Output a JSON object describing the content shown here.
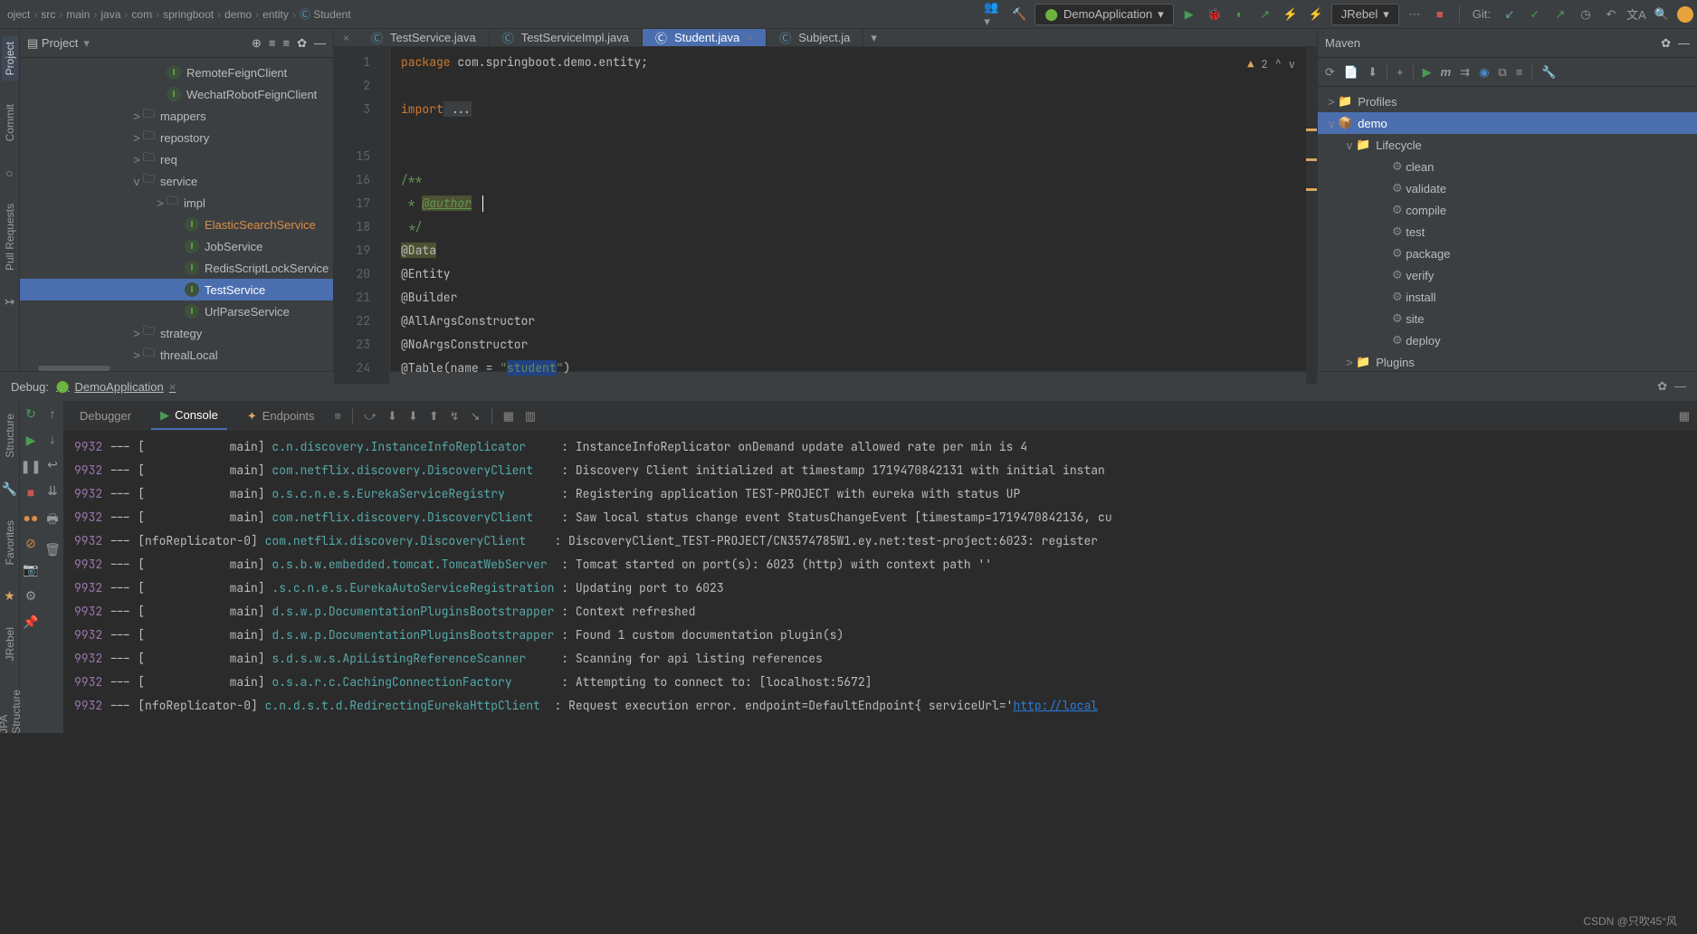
{
  "breadcrumb": [
    "oject",
    "src",
    "main",
    "java",
    "com",
    "springboot",
    "demo",
    "entity",
    "Student"
  ],
  "runConfig": "DemoApplication",
  "jrebel": "JRebel",
  "gitLabel": "Git:",
  "projectPanel": {
    "title": "Project",
    "tree": [
      {
        "ind": 0,
        "type": "iface",
        "label": "RemoteFeignClient"
      },
      {
        "ind": 0,
        "type": "iface",
        "label": "WechatRobotFeignClient"
      },
      {
        "ind": 1,
        "exp": ">",
        "type": "folder",
        "label": "mappers"
      },
      {
        "ind": 1,
        "exp": ">",
        "type": "folder",
        "label": "repostory"
      },
      {
        "ind": 1,
        "exp": ">",
        "type": "folder",
        "label": "req"
      },
      {
        "ind": 1,
        "exp": "v",
        "type": "folder",
        "label": "service"
      },
      {
        "ind": 2,
        "exp": ">",
        "type": "folder",
        "label": "impl"
      },
      {
        "ind": 3,
        "type": "iface",
        "label": "ElasticSearchService",
        "warn": true
      },
      {
        "ind": 3,
        "type": "iface",
        "label": "JobService"
      },
      {
        "ind": 3,
        "type": "iface",
        "label": "RedisScriptLockService"
      },
      {
        "ind": 3,
        "type": "iface",
        "label": "TestService",
        "selected": true
      },
      {
        "ind": 3,
        "type": "iface",
        "label": "UrlParseService"
      },
      {
        "ind": 1,
        "exp": ">",
        "type": "folder",
        "label": "strategy"
      },
      {
        "ind": 1,
        "exp": ">",
        "type": "folder",
        "label": "threalLocal"
      }
    ]
  },
  "tabs": [
    {
      "label": "TestService.java"
    },
    {
      "label": "TestServiceImpl.java"
    },
    {
      "label": "Student.java",
      "active": true
    },
    {
      "label": "Subject.ja"
    }
  ],
  "editor": {
    "lineNumbers": [
      "1",
      "2",
      "3",
      "",
      "15",
      "16",
      "17",
      "18",
      "19",
      "20",
      "21",
      "22",
      "23",
      "24"
    ],
    "errorBadge": "2"
  },
  "code": {
    "pkg_kw": "package",
    "pkg_path": " com.springboot.demo.entity;",
    "import_kw": "import",
    "import_more": " ...",
    "cstart": "/**",
    "cstar": " * ",
    "author_tag": "@author",
    "cend": " */",
    "a_data": "@Data",
    "a_entity": "@Entity",
    "a_builder": "@Builder",
    "a_all": "@AllArgsConstructor",
    "a_no": "@NoArgsConstructor",
    "a_table": "@Table",
    "table_args1": "(name = ",
    "table_q1": "\"",
    "table_val": "student",
    "table_q2": "\"",
    "table_args2": ")"
  },
  "maven": {
    "title": "Maven",
    "nodes": {
      "profiles": {
        "exp": ">",
        "label": "Profiles"
      },
      "demo": {
        "exp": "v",
        "label": "demo",
        "sel": true
      },
      "lifecycle": {
        "exp": "v",
        "label": "Lifecycle"
      },
      "goals": [
        "clean",
        "validate",
        "compile",
        "test",
        "package",
        "verify",
        "install",
        "site",
        "deploy"
      ],
      "plugins": {
        "exp": ">",
        "label": "Plugins"
      }
    }
  },
  "debug": {
    "title": "Debug:",
    "app": "DemoApplication",
    "tabs": {
      "debugger": "Debugger",
      "console": "Console",
      "endpoints": "Endpoints"
    }
  },
  "console": [
    {
      "pid": "9932",
      "thread": "--- [            main] ",
      "cls": "c.n.discovery.InstanceInfoReplicator    ",
      "msg": " : InstanceInfoReplicator onDemand update allowed rate per min is 4"
    },
    {
      "pid": "9932",
      "thread": "--- [            main] ",
      "cls": "com.netflix.discovery.DiscoveryClient   ",
      "msg": " : Discovery Client initialized at timestamp 1719470842131 with initial instan"
    },
    {
      "pid": "9932",
      "thread": "--- [            main] ",
      "cls": "o.s.c.n.e.s.EurekaServiceRegistry       ",
      "msg": " : Registering application TEST-PROJECT with eureka with status UP"
    },
    {
      "pid": "9932",
      "thread": "--- [            main] ",
      "cls": "com.netflix.discovery.DiscoveryClient   ",
      "msg": " : Saw local status change event StatusChangeEvent [timestamp=1719470842136, cu"
    },
    {
      "pid": "9932",
      "thread": "--- [nfoReplicator-0] ",
      "cls": "com.netflix.discovery.DiscoveryClient   ",
      "msg": " : DiscoveryClient_TEST-PROJECT/CN3574785W1.ey.net:test-project:6023: register"
    },
    {
      "pid": "9932",
      "thread": "--- [            main] ",
      "cls": "o.s.b.w.embedded.tomcat.TomcatWebServer ",
      "msg": " : Tomcat started on port(s): 6023 (http) with context path ''"
    },
    {
      "pid": "9932",
      "thread": "--- [            main] ",
      "cls": ".s.c.n.e.s.EurekaAutoServiceRegistration",
      "msg": " : Updating port to 6023"
    },
    {
      "pid": "9932",
      "thread": "--- [            main] ",
      "cls": "d.s.w.p.DocumentationPluginsBootstrapper",
      "msg": " : Context refreshed"
    },
    {
      "pid": "9932",
      "thread": "--- [            main] ",
      "cls": "d.s.w.p.DocumentationPluginsBootstrapper",
      "msg": " : Found 1 custom documentation plugin(s)"
    },
    {
      "pid": "9932",
      "thread": "--- [            main] ",
      "cls": "s.d.s.w.s.ApiListingReferenceScanner    ",
      "msg": " : Scanning for api listing references"
    },
    {
      "pid": "9932",
      "thread": "--- [            main] ",
      "cls": "o.s.a.r.c.CachingConnectionFactory      ",
      "msg": " : Attempting to connect to: [localhost:5672]"
    },
    {
      "pid": "9932",
      "thread": "--- [nfoReplicator-0] ",
      "cls": "c.n.d.s.t.d.RedirectingEurekaHttpClient ",
      "msg": " : Request execution error. endpoint=DefaultEndpoint{ serviceUrl='",
      "url": "http://local"
    }
  ],
  "leftTabs": {
    "project": "Project",
    "commit": "Commit",
    "pr": "Pull Requests",
    "structure": "Structure",
    "fav": "Favorites",
    "jrebel": "JRebel",
    "jpa": "JPA Structure"
  },
  "watermark": "CSDN @只吹45°风"
}
